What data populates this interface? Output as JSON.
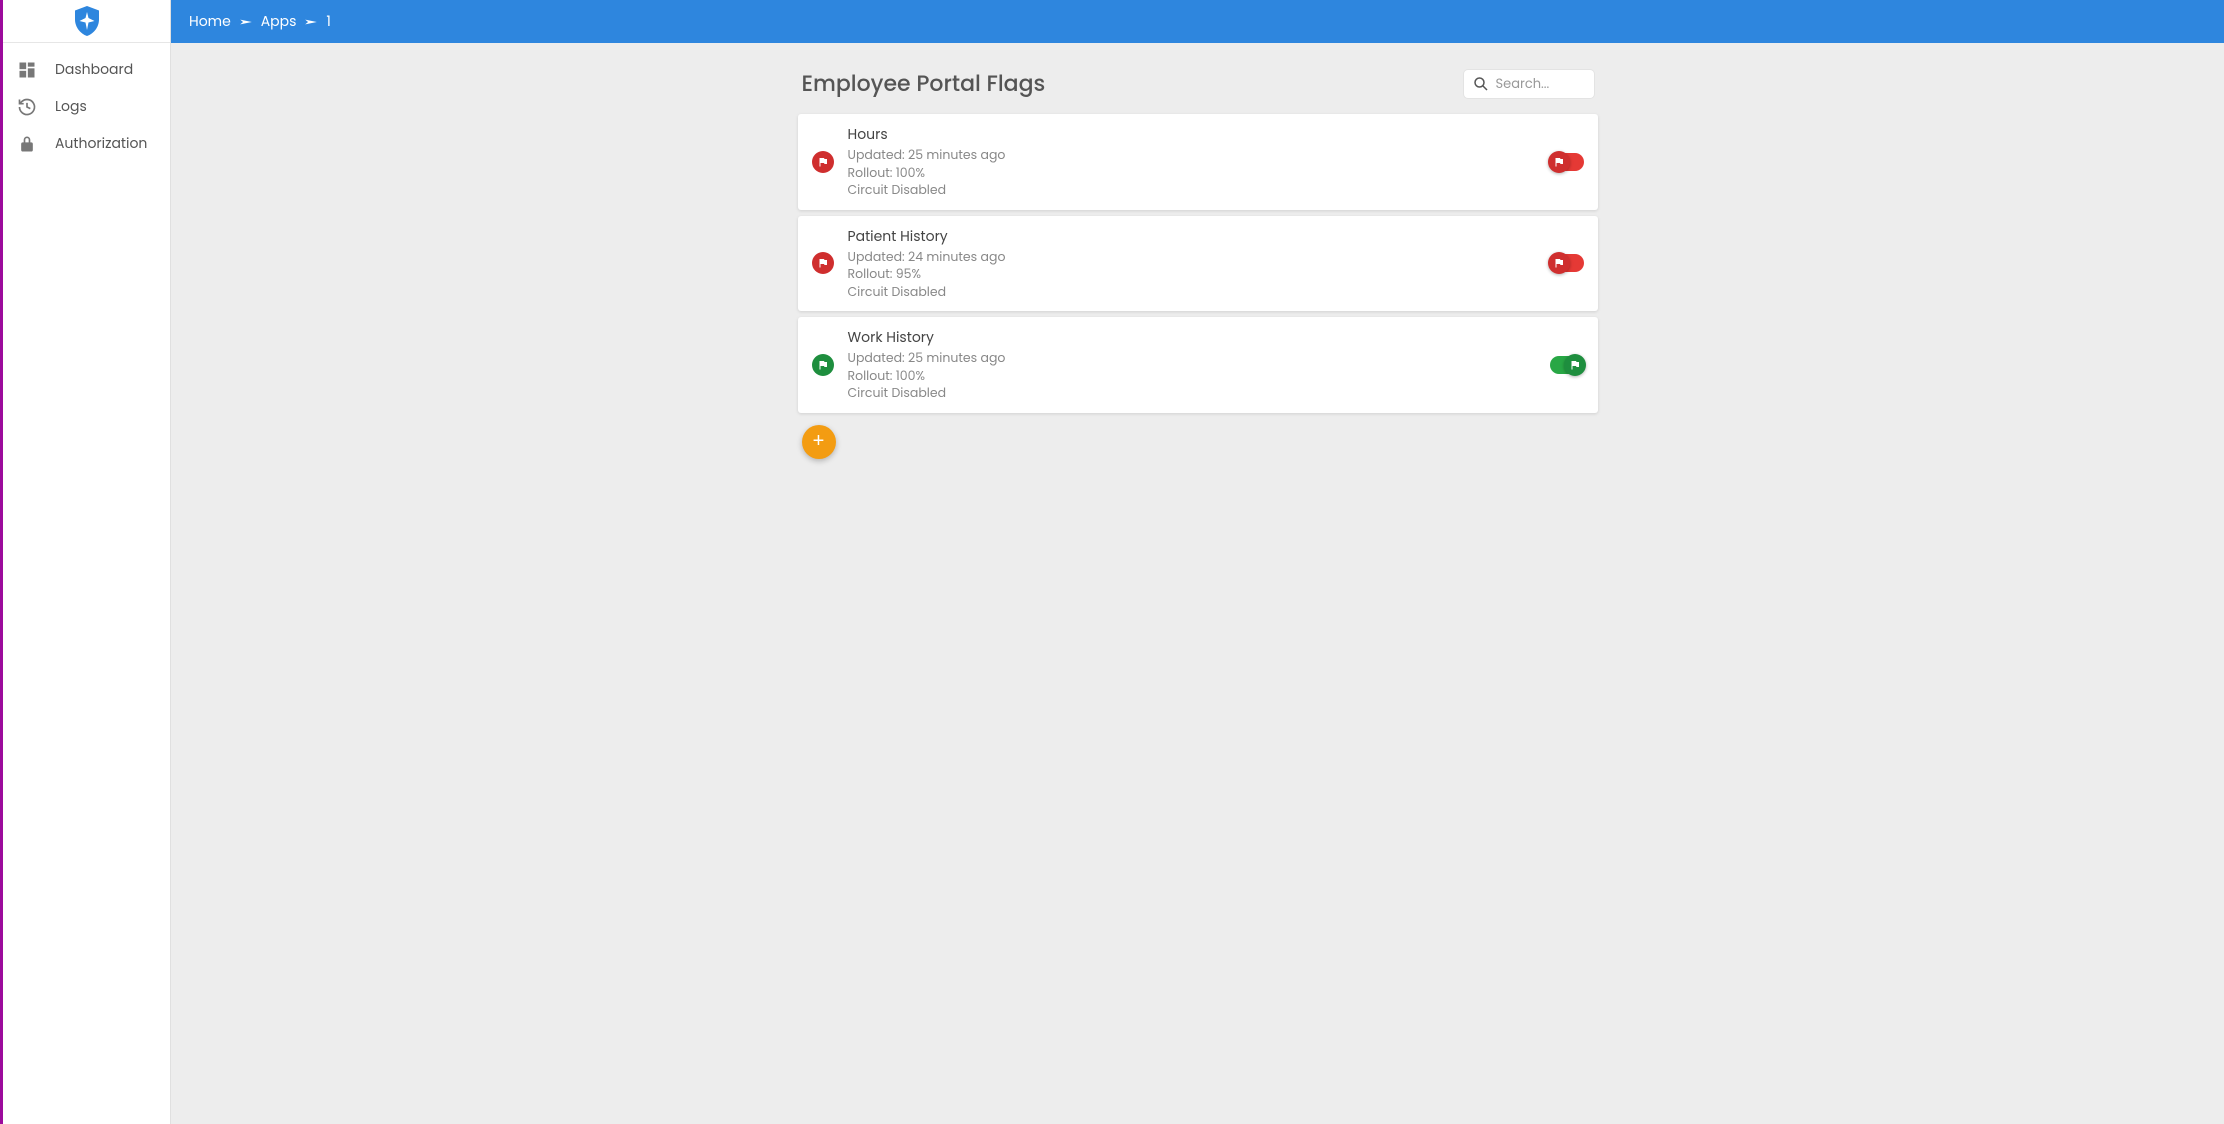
{
  "breadcrumb": {
    "home": "Home",
    "apps": "Apps",
    "id": "1"
  },
  "sidebar": {
    "items": [
      {
        "label": "Dashboard"
      },
      {
        "label": "Logs"
      },
      {
        "label": "Authorization"
      }
    ]
  },
  "page": {
    "title": "Employee Portal Flags",
    "search_placeholder": "Search..."
  },
  "labels": {
    "updated_prefix": "Updated: ",
    "rollout_prefix": "Rollout: "
  },
  "flags": [
    {
      "name": "Hours",
      "updated": "25 minutes ago",
      "rollout": "100%",
      "circuit": "Circuit Disabled",
      "enabled": false
    },
    {
      "name": "Patient History",
      "updated": "24 minutes ago",
      "rollout": "95%",
      "circuit": "Circuit Disabled",
      "enabled": false
    },
    {
      "name": "Work History",
      "updated": "25 minutes ago",
      "rollout": "100%",
      "circuit": "Circuit Disabled",
      "enabled": true
    }
  ],
  "fab": {
    "label": "+"
  }
}
